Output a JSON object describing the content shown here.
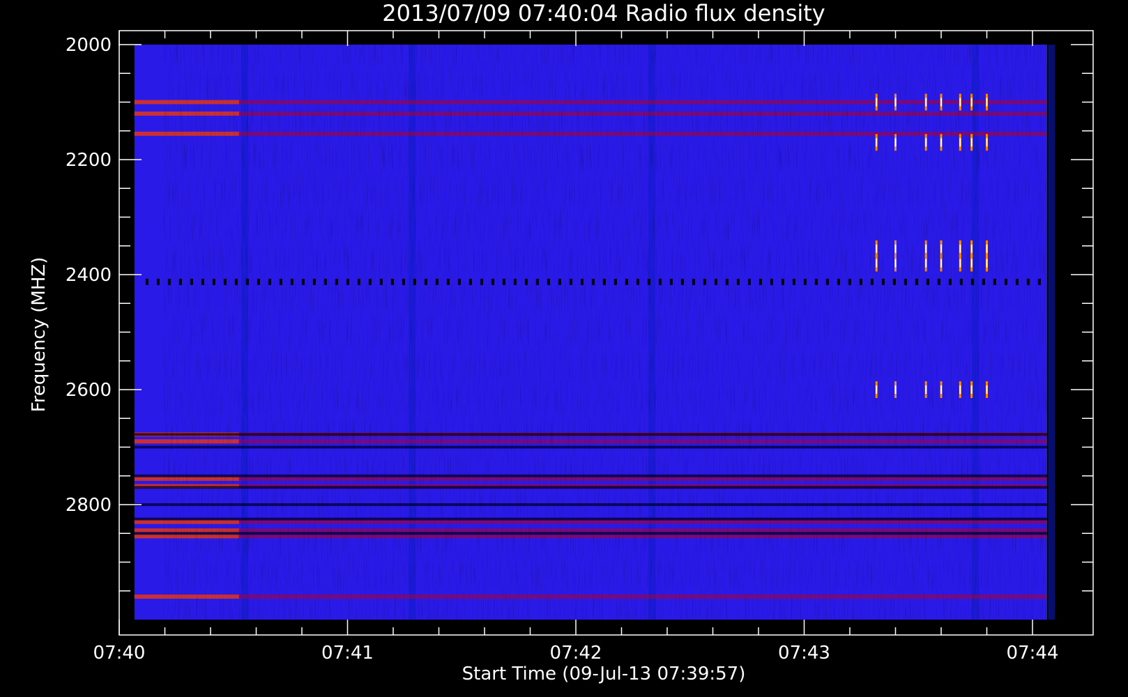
{
  "colors": {
    "background": "#000000",
    "axes": "#ffffff",
    "text": "#ffffff",
    "data_base": "#2a1ae8",
    "colormap": [
      "#000000",
      "#1010c0",
      "#2a1ae8",
      "#8a0060",
      "#c00000",
      "#ff8000",
      "#ffffff"
    ]
  },
  "chart_data": {
    "type": "heatmap",
    "title": "2013/07/09 07:40:04 Radio flux density",
    "xlabel": "Start Time (09-Jul-13 07:39:57)",
    "ylabel": "Frequency (MHZ)",
    "xlim": [
      "07:40:00",
      "07:44:06"
    ],
    "ylim": [
      2000,
      3000
    ],
    "y_inverted": true,
    "x_tick_labels": [
      "07:40",
      "07:41",
      "07:42",
      "07:43",
      "07:44"
    ],
    "x_tick_values_sec": [
      0,
      60,
      120,
      180,
      240
    ],
    "x_minor_step_sec": 12,
    "y_tick_labels": [
      "2000",
      "2200",
      "2400",
      "2600",
      "2800"
    ],
    "y_tick_values": [
      2000,
      2200,
      2400,
      2600,
      2800
    ],
    "y_minor_step": 50,
    "data_extent": {
      "x_sec_start": 4,
      "x_sec_end": 244,
      "y_start": 2000,
      "y_end": 3000
    },
    "grid": false,
    "colorbar": false,
    "features": {
      "red_bands_mhz": [
        2100,
        2120,
        2155,
        2678,
        2690,
        2755,
        2768,
        2830,
        2845,
        2855,
        2960
      ],
      "dark_bands_mhz": [
        2678,
        2700,
        2750,
        2770,
        2800,
        2825,
        2850
      ],
      "dotted_line_mhz": 2412,
      "dark_columns_sec": [
        33,
        77,
        140,
        225,
        245
      ],
      "bright_columns_sec": [
        199,
        204,
        212,
        216,
        221,
        224,
        228
      ],
      "burst_region_sec": [
        185,
        233
      ]
    }
  }
}
